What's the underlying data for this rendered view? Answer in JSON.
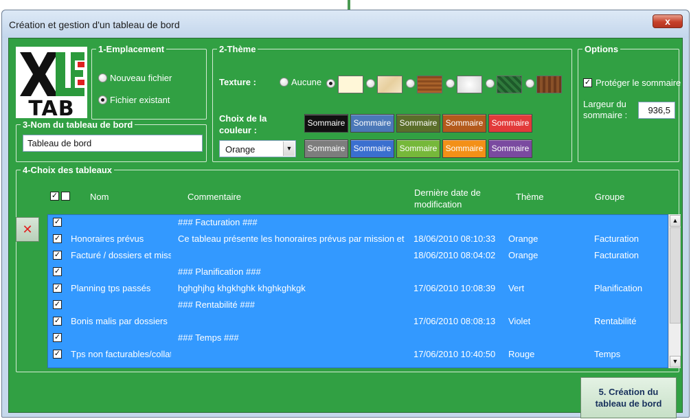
{
  "window": {
    "title": "Création et gestion d'un tableau de bord",
    "close_label": "x"
  },
  "logo": {
    "line1": "XL",
    "line1b": "E",
    "line2": "TAB"
  },
  "emplacement": {
    "title": "1-Emplacement",
    "options": [
      {
        "label": "Nouveau fichier",
        "selected": false
      },
      {
        "label": "Fichier existant",
        "selected": true
      }
    ]
  },
  "theme": {
    "title": "2-Thème",
    "texture_label": "Texture :",
    "texture_none_label": "Aucune",
    "couleur_label": "Choix de la couleur :",
    "couleur_selected": "Orange",
    "button_label": "Sommaire",
    "colors_row1": [
      "#111111",
      "#4b78b8",
      "#5a6e2a",
      "#b35a1c",
      "#e23a3a"
    ],
    "colors_row2": [
      "#7d7d7d",
      "#3a6fcf",
      "#76b83a",
      "#f39017",
      "#7a4aa0"
    ]
  },
  "nom_tableau": {
    "title": "3-Nom du tableau de bord",
    "value": "Tableau de bord"
  },
  "options": {
    "title": "Options",
    "protect_label": "Protéger le sommaire",
    "protect_checked": true,
    "largeur_label": "Largeur du sommaire :",
    "largeur_value": "936,5"
  },
  "choix": {
    "title": "4-Choix des tableaux",
    "columns": {
      "nom": "Nom",
      "commentaire": "Commentaire",
      "date": "Dernière date de modification",
      "theme": "Thème",
      "groupe": "Groupe"
    },
    "rows": [
      {
        "group_header": "### Facturation ###"
      },
      {
        "nom": "Honoraires prévus",
        "commentaire": "Ce tableau présente les honoraires prévus par mission et de",
        "date": "18/06/2010 08:10:33",
        "theme": "Orange",
        "groupe": "Facturation"
      },
      {
        "nom": "Facturé / dossiers et missi",
        "commentaire": "",
        "date": "18/06/2010 08:04:02",
        "theme": "Orange",
        "groupe": "Facturation"
      },
      {
        "group_header": "### Planification ###"
      },
      {
        "nom": "Planning tps passés",
        "commentaire": "hghghjhg khgkhghk khghkghkgk",
        "date": "17/06/2010 10:08:39",
        "theme": "Vert",
        "groupe": "Planification"
      },
      {
        "group_header": "### Rentabilité ###"
      },
      {
        "nom": "Bonis malis par dossiers",
        "commentaire": "",
        "date": "17/06/2010 08:08:13",
        "theme": "Violet",
        "groupe": "Rentabilité"
      },
      {
        "group_header": "### Temps ###"
      },
      {
        "nom": "Tps non facturables/collat",
        "commentaire": "",
        "date": "17/06/2010 10:40:50",
        "theme": "Rouge",
        "groupe": "Temps"
      }
    ]
  },
  "create_button": {
    "line1": "5. Création du",
    "line2": "tableau de bord"
  }
}
